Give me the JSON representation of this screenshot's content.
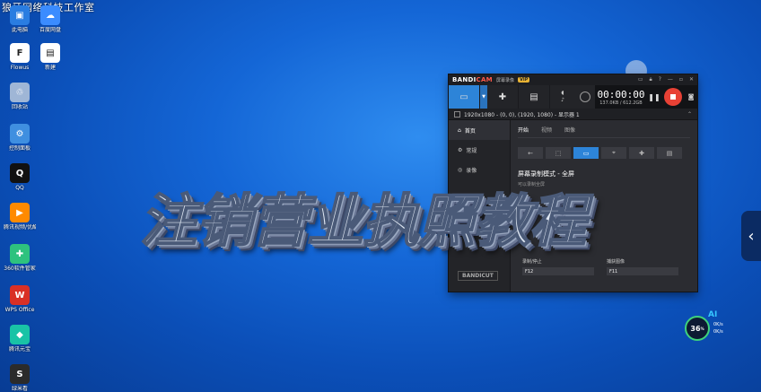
{
  "watermark": "狼牙网络科技工作室",
  "desktop_icons": [
    {
      "label": "此电脑",
      "color": "#2a7de1",
      "glyph": "▣"
    },
    {
      "label": "百度网盘",
      "color": "#3b8cff",
      "glyph": "☁"
    },
    {
      "label": "Flowus",
      "color": "#ffffff",
      "glyph": "F"
    },
    {
      "label": "新建",
      "color": "#ffffff",
      "glyph": "▤"
    },
    {
      "label": "回收站",
      "color": "#9fb6d6",
      "glyph": "♲"
    },
    {
      "label": "控制面板",
      "color": "#3f8fe0",
      "glyph": "⚙"
    },
    {
      "label": "QQ",
      "color": "#111111",
      "glyph": "Q"
    },
    {
      "label": "腾讯视频/优酷/爱奇艺",
      "color": "#ff8a00",
      "glyph": "▶"
    },
    {
      "label": "360软件管家",
      "color": "#2ec27e",
      "glyph": "✚"
    },
    {
      "label": "WPS Office",
      "color": "#d93025",
      "glyph": "W"
    },
    {
      "label": "腾讯元宝",
      "color": "#19c3a6",
      "glyph": "◆"
    },
    {
      "label": "绿米看",
      "color": "#2b2b2b",
      "glyph": "S"
    }
  ],
  "bandicam": {
    "logo_a": "BANDI",
    "logo_b": "CAM",
    "edition": "屏幕录像",
    "vip": "VIP",
    "title_icons": [
      "folder-icon",
      "lock-icon",
      "help-icon",
      "minimize-icon",
      "maximize-icon",
      "close-icon"
    ],
    "timer": "00:00:00",
    "size": "137.0KB / 612.2GB",
    "region": "1920x1080 - (0, 0), (1920, 1080) - 显示器 1",
    "side": [
      {
        "label": "首页",
        "glyph": "⌂"
      },
      {
        "label": "常规",
        "glyph": "⚙"
      },
      {
        "label": "录像",
        "glyph": "◎"
      }
    ],
    "side_logo": "BANDICUT",
    "tabs": [
      {
        "label": "开始"
      },
      {
        "label": "视频"
      },
      {
        "label": "图像"
      }
    ],
    "mode_title": "屏幕录制模式 - 全屏",
    "mode_desc": "可以录制全屏",
    "hotkeys": [
      {
        "label": "录制/停止",
        "value": "F12"
      },
      {
        "label": "捕获图像",
        "value": "F11"
      }
    ]
  },
  "overlay_title": "注销营业执照教程",
  "speed": {
    "percent": "36",
    "unit": "%",
    "up": "0K/s",
    "down": "0K/s",
    "ai": "AI"
  }
}
